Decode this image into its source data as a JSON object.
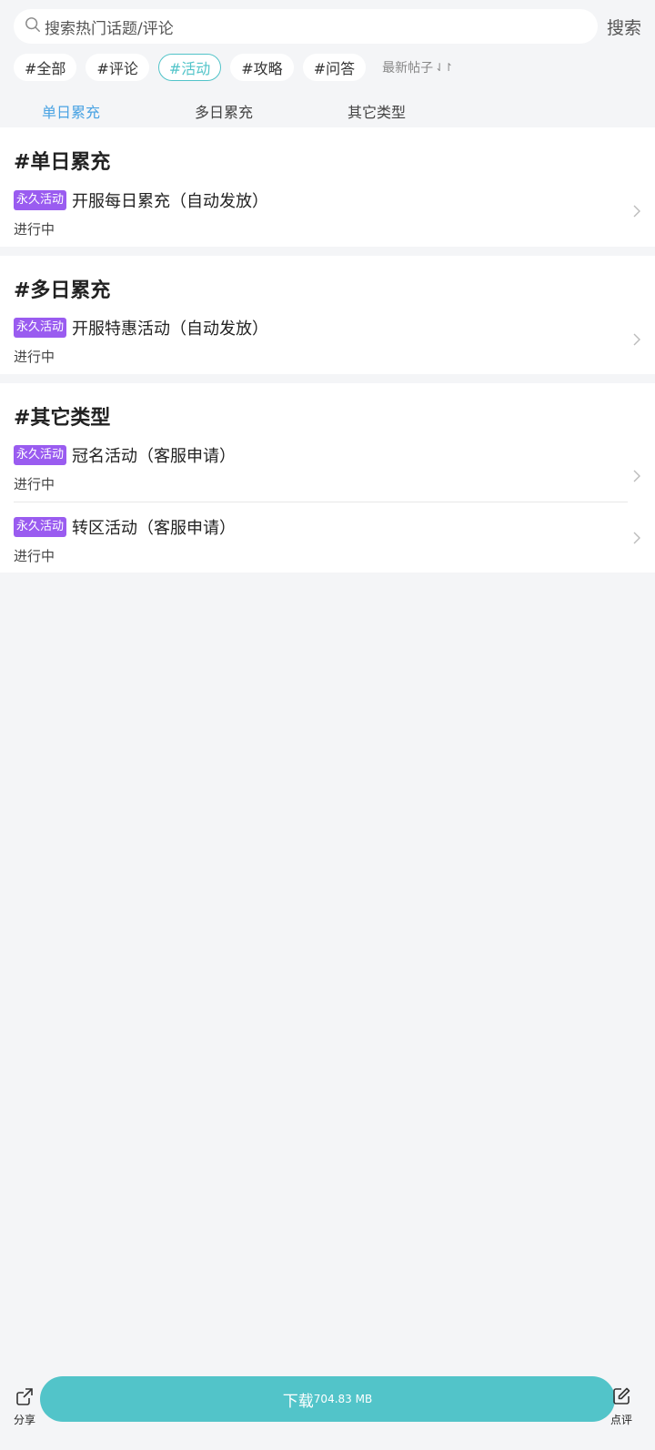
{
  "search": {
    "placeholder": "搜索热门话题/评论",
    "button_label": "搜索"
  },
  "topic_chips": [
    {
      "label": "#全部",
      "active": false
    },
    {
      "label": "#评论",
      "active": false
    },
    {
      "label": "#活动",
      "active": true
    },
    {
      "label": "#攻略",
      "active": false
    },
    {
      "label": "#问答",
      "active": false
    }
  ],
  "sort": {
    "label": "最新帖子",
    "icon": "sort-arrows-icon"
  },
  "subtabs": [
    {
      "label": "单日累充",
      "active": true
    },
    {
      "label": "多日累充",
      "active": false
    },
    {
      "label": "其它类型",
      "active": false
    }
  ],
  "sections": [
    {
      "title": "#单日累充",
      "items": [
        {
          "badge": "永久活动",
          "title": "开服每日累充（自动发放）",
          "status": "进行中"
        }
      ]
    },
    {
      "title": "#多日累充",
      "items": [
        {
          "badge": "永久活动",
          "title": "开服特惠活动（自动发放）",
          "status": "进行中"
        }
      ]
    },
    {
      "title": "#其它类型",
      "items": [
        {
          "badge": "永久活动",
          "title": "冠名活动（客服申请）",
          "status": "进行中"
        },
        {
          "badge": "永久活动",
          "title": "转区活动（客服申请）",
          "status": "进行中"
        }
      ]
    }
  ],
  "bottom_bar": {
    "share_label": "分享",
    "download_label": "下载",
    "download_size": "704.83 MB",
    "review_label": "点评"
  },
  "colors": {
    "accent": "#52c4c9",
    "tab_active": "#4aa3e3",
    "badge": "#9a5cf0",
    "background": "#f4f5f7"
  }
}
